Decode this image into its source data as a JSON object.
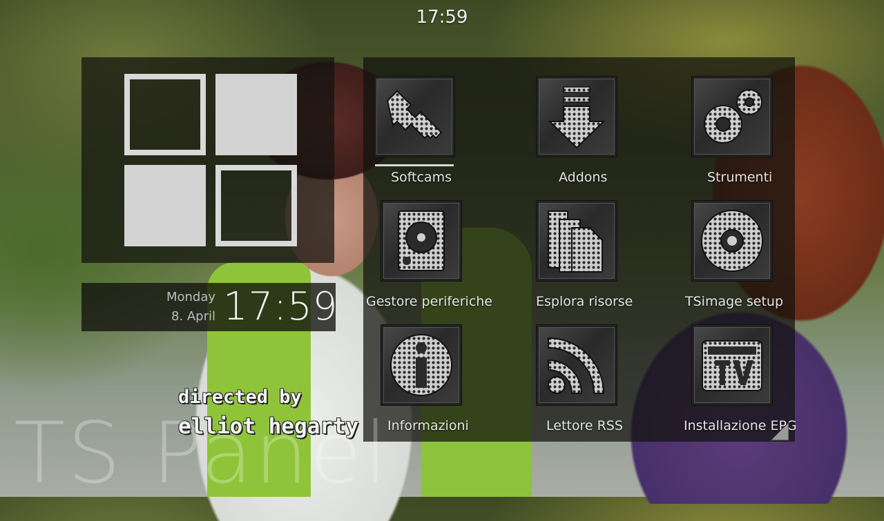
{
  "top_clock": "17:59",
  "clock_widget": {
    "day": "Monday",
    "date": "8. April",
    "time": "17:59"
  },
  "menu": {
    "items": [
      {
        "label": "Softcams",
        "icon": "key-icon",
        "selected": true
      },
      {
        "label": "Addons",
        "icon": "download-arrow-icon",
        "selected": false
      },
      {
        "label": "Strumenti",
        "icon": "gears-icon",
        "selected": false
      },
      {
        "label": "Gestore periferiche",
        "icon": "hard-drive-icon",
        "selected": false
      },
      {
        "label": "Esplora risorse",
        "icon": "files-icon",
        "selected": false
      },
      {
        "label": "TSimage setup",
        "icon": "disc-icon",
        "selected": false
      },
      {
        "label": "Informazioni",
        "icon": "info-icon",
        "selected": false
      },
      {
        "label": "Lettore RSS",
        "icon": "rss-icon",
        "selected": false
      },
      {
        "label": "Installazione EPG",
        "icon": "tv-guide-icon",
        "selected": false
      }
    ]
  },
  "video_overlay": {
    "line1": "directed by",
    "line2": "elliot hegarty"
  },
  "watermark": "TS Panel",
  "colors": {
    "panel": "#12120e",
    "tile": "#d3d3d3",
    "text": "#e4e4e4"
  }
}
